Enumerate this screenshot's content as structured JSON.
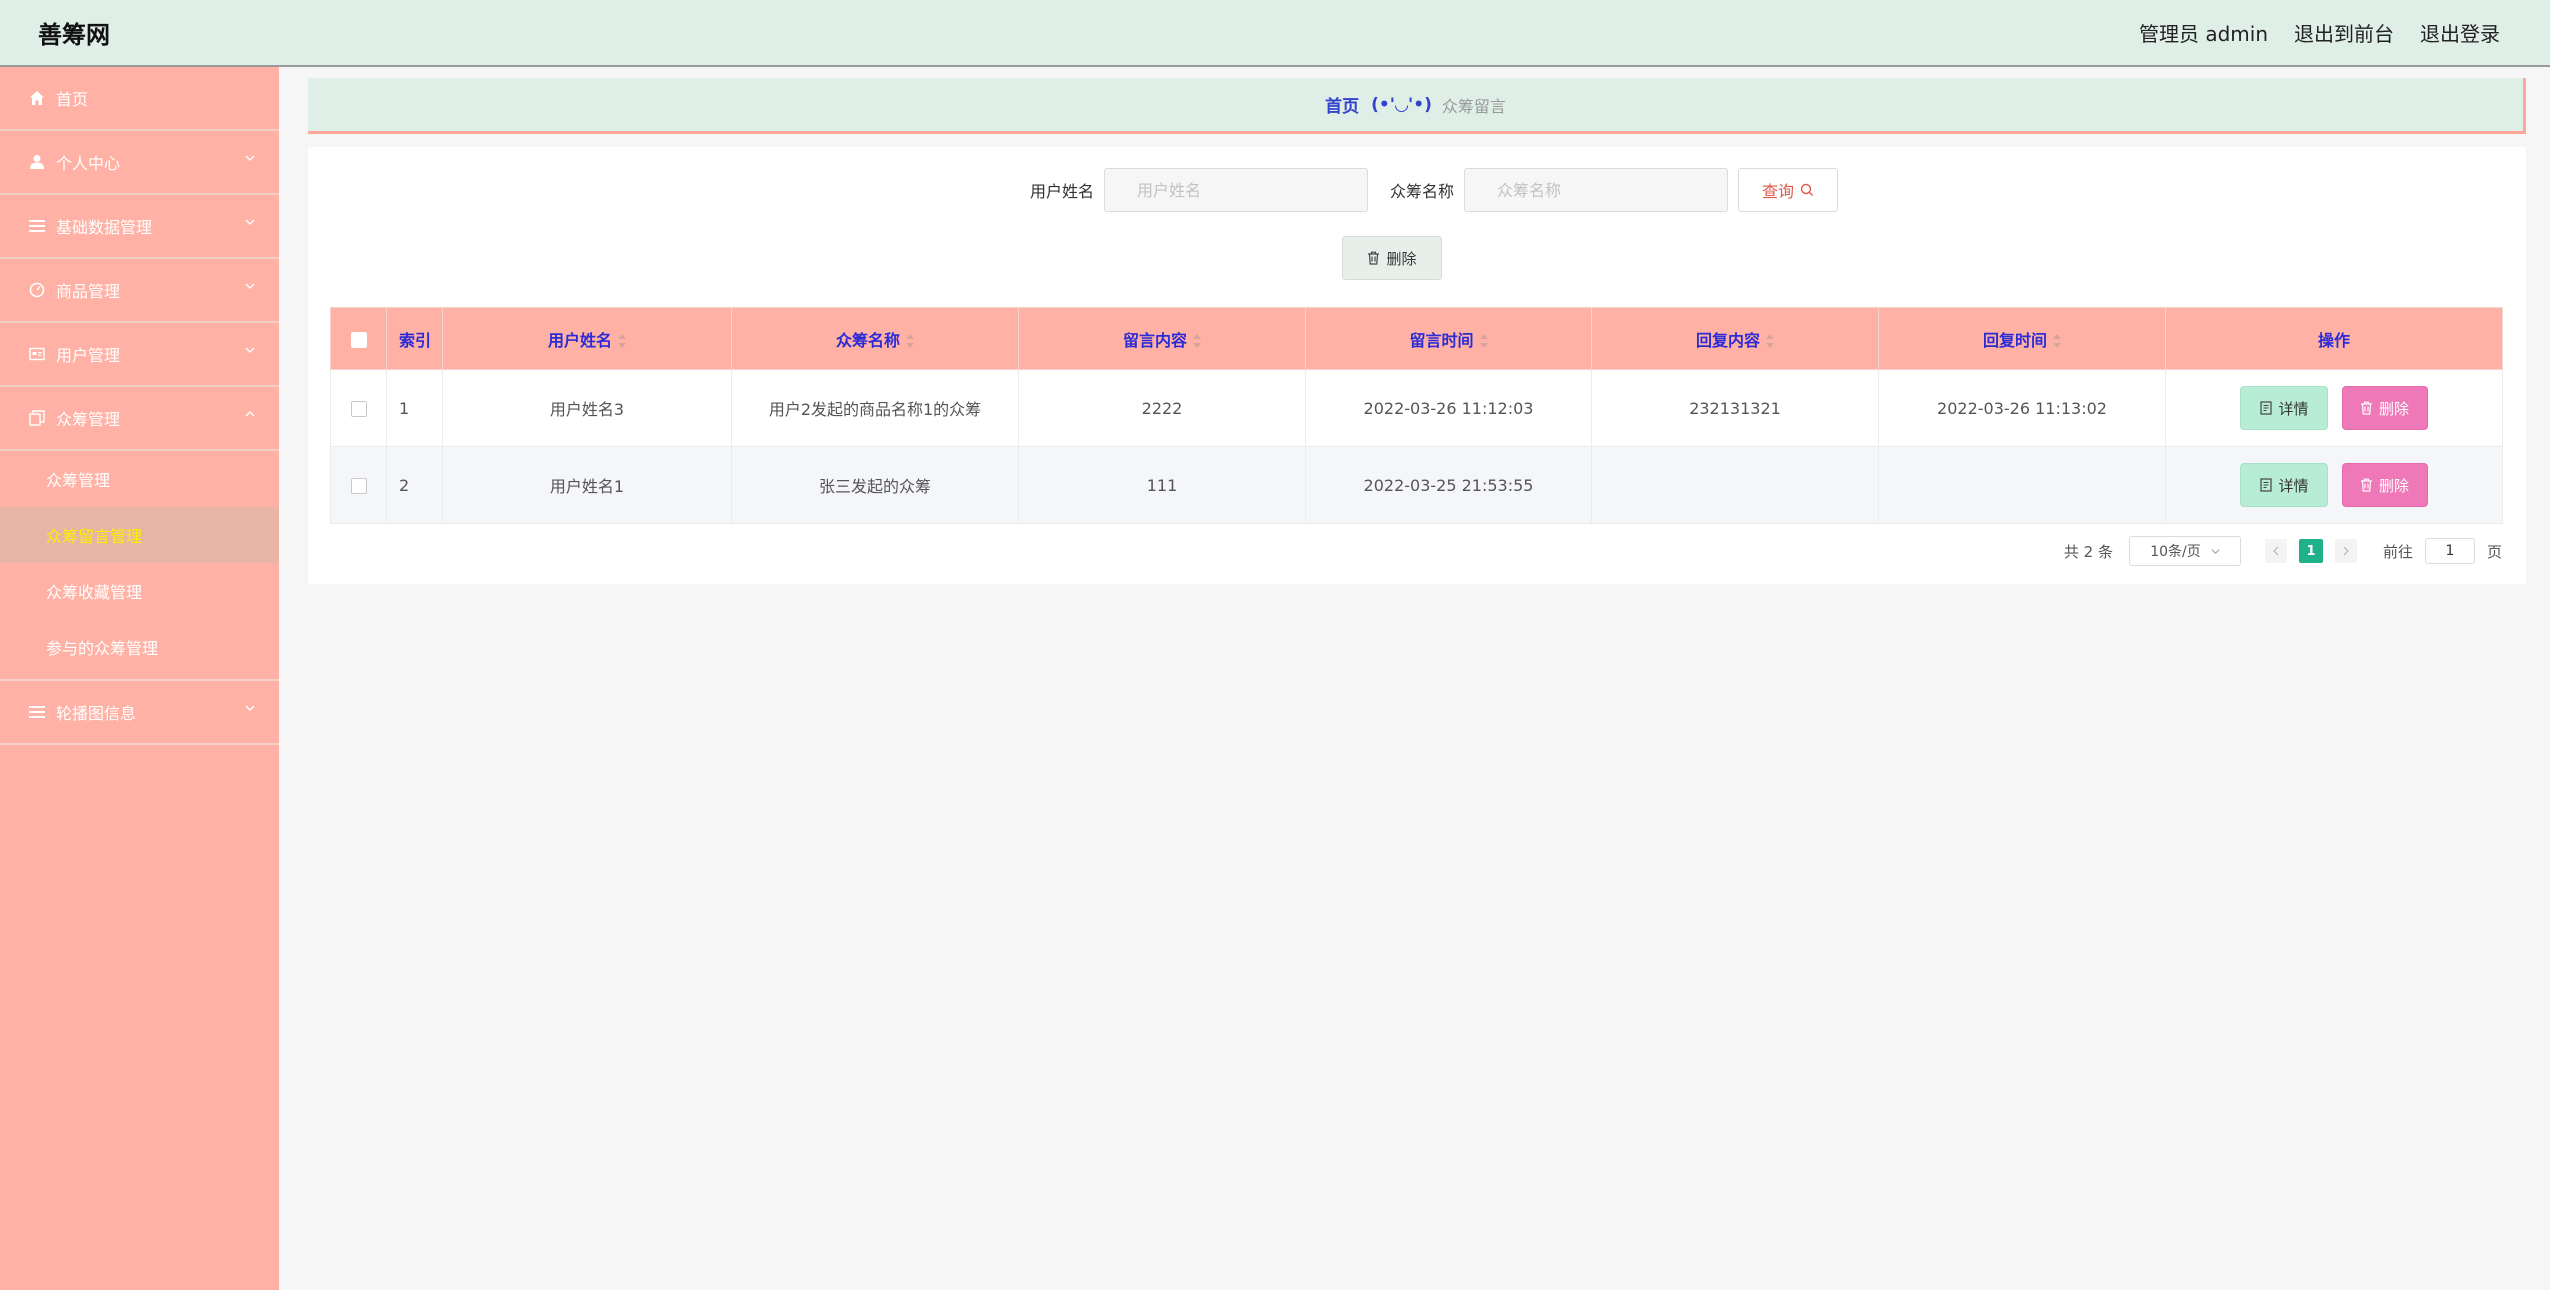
{
  "app": {
    "brand": "善筹网"
  },
  "topnav": {
    "user": "管理员 admin",
    "front": "退出到前台",
    "logout": "退出登录"
  },
  "sidebar": {
    "items": [
      {
        "label": "首页",
        "icon": "home-icon"
      },
      {
        "label": "个人中心",
        "icon": "user-icon"
      },
      {
        "label": "基础数据管理",
        "icon": "list-icon"
      },
      {
        "label": "商品管理",
        "icon": "dashboard-icon"
      },
      {
        "label": "用户管理",
        "icon": "id-card-icon"
      },
      {
        "label": "众筹管理",
        "icon": "copy-icon"
      }
    ],
    "sub_items": [
      {
        "label": "众筹管理"
      },
      {
        "label": "众筹留言管理"
      },
      {
        "label": "众筹收藏管理"
      },
      {
        "label": "参与的众筹管理"
      }
    ],
    "last_item": {
      "label": "轮播图信息",
      "icon": "list-icon"
    }
  },
  "breadcrumb": {
    "home": "首页",
    "face": "(•'◡'•)",
    "current": "众筹留言"
  },
  "search": {
    "user_label": "用户姓名",
    "user_placeholder": "用户姓名",
    "crowd_label": "众筹名称",
    "crowd_placeholder": "众筹名称",
    "query_label": "查询"
  },
  "toolbar": {
    "delete_label": "删除"
  },
  "table": {
    "headers": [
      "索引",
      "用户姓名",
      "众筹名称",
      "留言内容",
      "留言时间",
      "回复内容",
      "回复时间",
      "操作"
    ],
    "rows": [
      {
        "index": "1",
        "user": "用户姓名3",
        "crowd": "用户2发起的商品名称1的众筹",
        "message": "2222",
        "msg_time": "2022-03-26 11:12:03",
        "reply": "232131321",
        "reply_time": "2022-03-26 11:13:02"
      },
      {
        "index": "2",
        "user": "用户姓名1",
        "crowd": "张三发起的众筹",
        "message": "111",
        "msg_time": "2022-03-25 21:53:55",
        "reply": "",
        "reply_time": ""
      }
    ],
    "detail_label": "详情",
    "delete_label": "删除"
  },
  "pager": {
    "total": "共 2 条",
    "page_size": "10条/页",
    "current": "1",
    "goto_label": "前往",
    "goto_value": "1",
    "page_unit": "页"
  },
  "colors": {
    "sidebar": "#ffb1a5",
    "topbar": "#dfeee7",
    "header_text": "#2c2cd6",
    "active_sub": "#fcf000",
    "detail": "#b7ecd5",
    "delete": "#ef79b8",
    "page_active": "#1fb18a"
  }
}
